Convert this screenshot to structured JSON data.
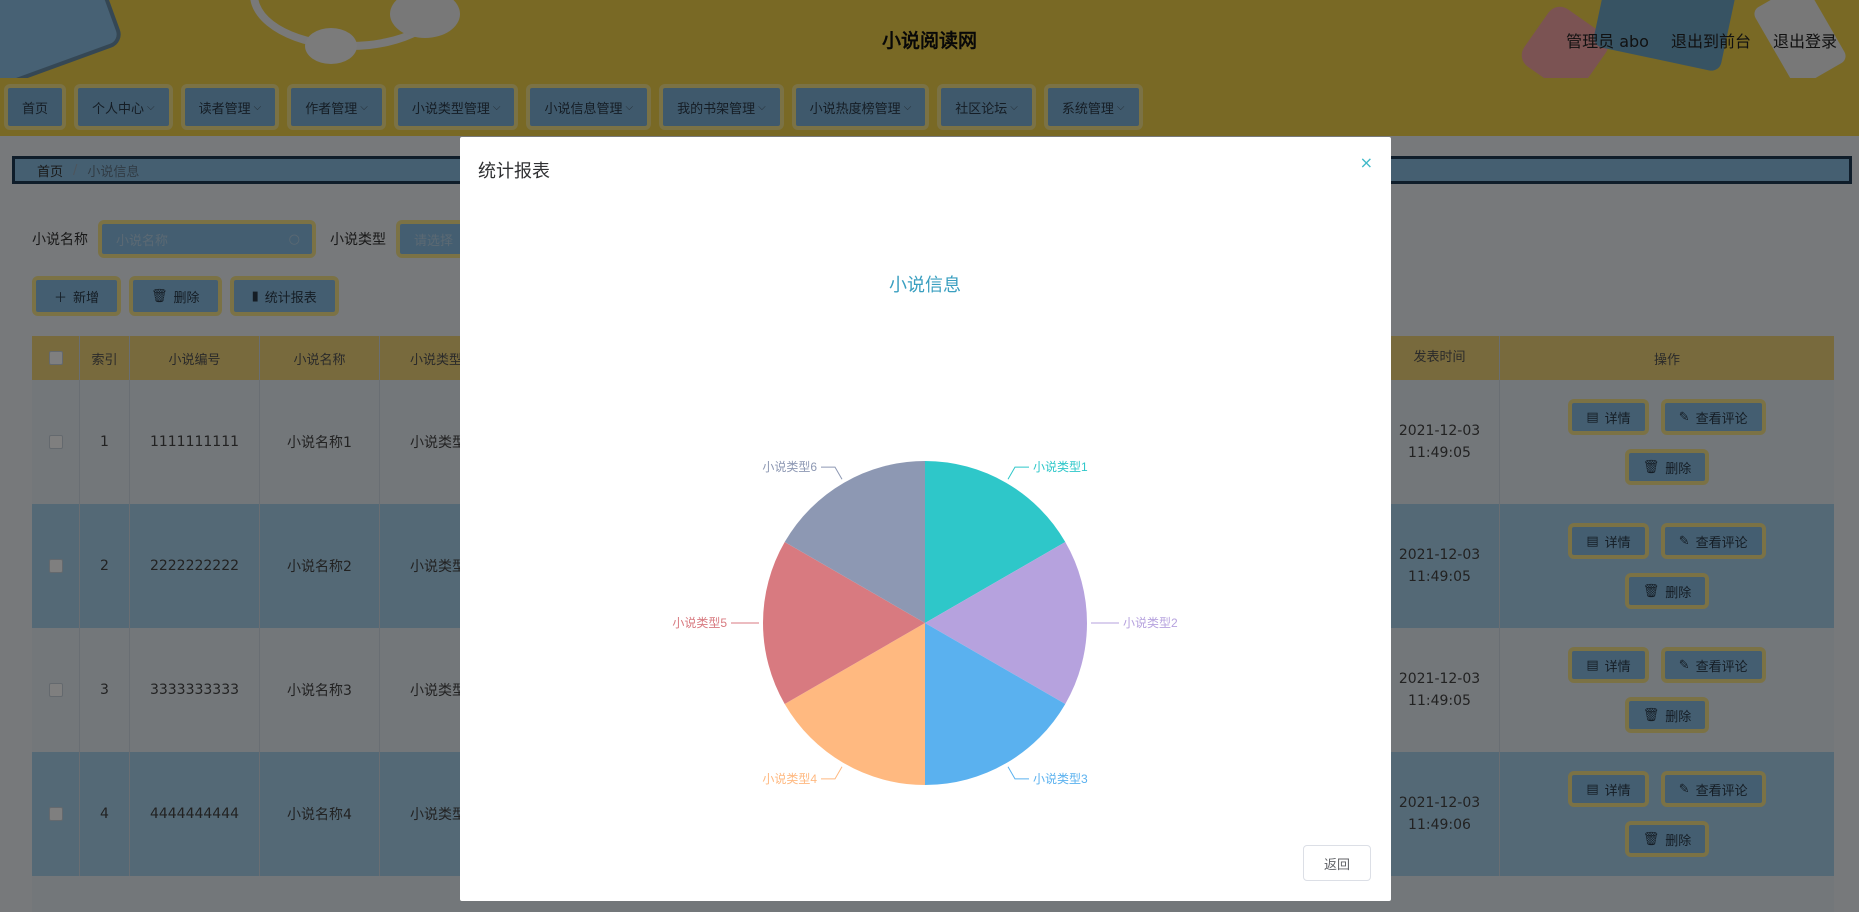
{
  "header": {
    "site_title": "小说阅读网",
    "links": [
      "管理员 abo",
      "退出到前台",
      "退出登录"
    ]
  },
  "nav": {
    "items": [
      {
        "label": "首页",
        "has_dropdown": false
      },
      {
        "label": "个人中心",
        "has_dropdown": true
      },
      {
        "label": "读者管理",
        "has_dropdown": true
      },
      {
        "label": "作者管理",
        "has_dropdown": true
      },
      {
        "label": "小说类型管理",
        "has_dropdown": true
      },
      {
        "label": "小说信息管理",
        "has_dropdown": true
      },
      {
        "label": "我的书架管理",
        "has_dropdown": true
      },
      {
        "label": "小说热度榜管理",
        "has_dropdown": true
      },
      {
        "label": "社区论坛",
        "has_dropdown": true
      },
      {
        "label": "系统管理",
        "has_dropdown": true
      }
    ]
  },
  "breadcrumb": {
    "home": "首页",
    "current": "小说信息"
  },
  "search": {
    "name_label": "小说名称",
    "name_placeholder": "小说名称",
    "type_label": "小说类型",
    "type_placeholder": "请选择"
  },
  "toolbar": {
    "add": "新增",
    "delete": "删除",
    "report": "统计报表"
  },
  "table": {
    "headers": {
      "index": "索引",
      "code": "小说编号",
      "name": "小说名称",
      "type": "小说类型",
      "time": "发表时间",
      "ops": "操作"
    },
    "rows": [
      {
        "index": "1",
        "code": "1111111111",
        "name": "小说名称1",
        "type": "小说类型",
        "time": "2021-12-03 11:49:05"
      },
      {
        "index": "2",
        "code": "2222222222",
        "name": "小说名称2",
        "type": "小说类型",
        "time": "2021-12-03 11:49:05"
      },
      {
        "index": "3",
        "code": "3333333333",
        "name": "小说名称3",
        "type": "小说类型",
        "time": "2021-12-03 11:49:05"
      },
      {
        "index": "4",
        "code": "4444444444",
        "name": "小说名称4",
        "type": "小说类型",
        "time": "2021-12-03 11:49:06"
      }
    ],
    "op_labels": {
      "detail": "详情",
      "comments": "查看评论",
      "delete": "删除"
    }
  },
  "modal": {
    "title": "统计报表",
    "close_glyph": "×",
    "back_label": "返回"
  },
  "chart_data": {
    "type": "pie",
    "title": "小说信息",
    "categories": [
      "小说类型1",
      "小说类型2",
      "小说类型3",
      "小说类型4",
      "小说类型5",
      "小说类型6"
    ],
    "values": [
      1,
      1,
      1,
      1,
      1,
      1
    ],
    "colors": [
      "#2ec7c9",
      "#b6a2de",
      "#5ab1ef",
      "#ffb980",
      "#d87a80",
      "#8d98b3"
    ],
    "title_color": "#3a9fc0"
  }
}
